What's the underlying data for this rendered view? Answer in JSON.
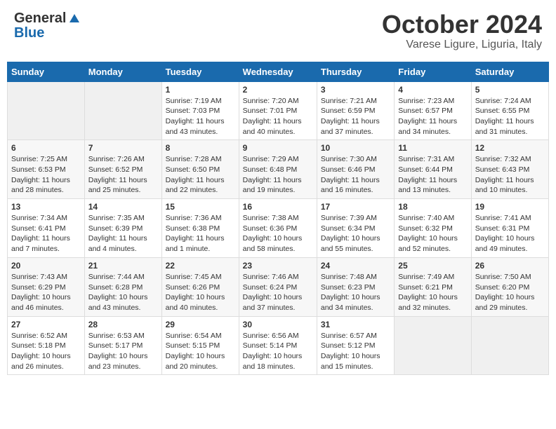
{
  "header": {
    "logo_general": "General",
    "logo_blue": "Blue",
    "month": "October 2024",
    "location": "Varese Ligure, Liguria, Italy"
  },
  "weekdays": [
    "Sunday",
    "Monday",
    "Tuesday",
    "Wednesday",
    "Thursday",
    "Friday",
    "Saturday"
  ],
  "weeks": [
    [
      {
        "day": "",
        "sunrise": "",
        "sunset": "",
        "daylight": ""
      },
      {
        "day": "",
        "sunrise": "",
        "sunset": "",
        "daylight": ""
      },
      {
        "day": "1",
        "sunrise": "Sunrise: 7:19 AM",
        "sunset": "Sunset: 7:03 PM",
        "daylight": "Daylight: 11 hours and 43 minutes."
      },
      {
        "day": "2",
        "sunrise": "Sunrise: 7:20 AM",
        "sunset": "Sunset: 7:01 PM",
        "daylight": "Daylight: 11 hours and 40 minutes."
      },
      {
        "day": "3",
        "sunrise": "Sunrise: 7:21 AM",
        "sunset": "Sunset: 6:59 PM",
        "daylight": "Daylight: 11 hours and 37 minutes."
      },
      {
        "day": "4",
        "sunrise": "Sunrise: 7:23 AM",
        "sunset": "Sunset: 6:57 PM",
        "daylight": "Daylight: 11 hours and 34 minutes."
      },
      {
        "day": "5",
        "sunrise": "Sunrise: 7:24 AM",
        "sunset": "Sunset: 6:55 PM",
        "daylight": "Daylight: 11 hours and 31 minutes."
      }
    ],
    [
      {
        "day": "6",
        "sunrise": "Sunrise: 7:25 AM",
        "sunset": "Sunset: 6:53 PM",
        "daylight": "Daylight: 11 hours and 28 minutes."
      },
      {
        "day": "7",
        "sunrise": "Sunrise: 7:26 AM",
        "sunset": "Sunset: 6:52 PM",
        "daylight": "Daylight: 11 hours and 25 minutes."
      },
      {
        "day": "8",
        "sunrise": "Sunrise: 7:28 AM",
        "sunset": "Sunset: 6:50 PM",
        "daylight": "Daylight: 11 hours and 22 minutes."
      },
      {
        "day": "9",
        "sunrise": "Sunrise: 7:29 AM",
        "sunset": "Sunset: 6:48 PM",
        "daylight": "Daylight: 11 hours and 19 minutes."
      },
      {
        "day": "10",
        "sunrise": "Sunrise: 7:30 AM",
        "sunset": "Sunset: 6:46 PM",
        "daylight": "Daylight: 11 hours and 16 minutes."
      },
      {
        "day": "11",
        "sunrise": "Sunrise: 7:31 AM",
        "sunset": "Sunset: 6:44 PM",
        "daylight": "Daylight: 11 hours and 13 minutes."
      },
      {
        "day": "12",
        "sunrise": "Sunrise: 7:32 AM",
        "sunset": "Sunset: 6:43 PM",
        "daylight": "Daylight: 11 hours and 10 minutes."
      }
    ],
    [
      {
        "day": "13",
        "sunrise": "Sunrise: 7:34 AM",
        "sunset": "Sunset: 6:41 PM",
        "daylight": "Daylight: 11 hours and 7 minutes."
      },
      {
        "day": "14",
        "sunrise": "Sunrise: 7:35 AM",
        "sunset": "Sunset: 6:39 PM",
        "daylight": "Daylight: 11 hours and 4 minutes."
      },
      {
        "day": "15",
        "sunrise": "Sunrise: 7:36 AM",
        "sunset": "Sunset: 6:38 PM",
        "daylight": "Daylight: 11 hours and 1 minute."
      },
      {
        "day": "16",
        "sunrise": "Sunrise: 7:38 AM",
        "sunset": "Sunset: 6:36 PM",
        "daylight": "Daylight: 10 hours and 58 minutes."
      },
      {
        "day": "17",
        "sunrise": "Sunrise: 7:39 AM",
        "sunset": "Sunset: 6:34 PM",
        "daylight": "Daylight: 10 hours and 55 minutes."
      },
      {
        "day": "18",
        "sunrise": "Sunrise: 7:40 AM",
        "sunset": "Sunset: 6:32 PM",
        "daylight": "Daylight: 10 hours and 52 minutes."
      },
      {
        "day": "19",
        "sunrise": "Sunrise: 7:41 AM",
        "sunset": "Sunset: 6:31 PM",
        "daylight": "Daylight: 10 hours and 49 minutes."
      }
    ],
    [
      {
        "day": "20",
        "sunrise": "Sunrise: 7:43 AM",
        "sunset": "Sunset: 6:29 PM",
        "daylight": "Daylight: 10 hours and 46 minutes."
      },
      {
        "day": "21",
        "sunrise": "Sunrise: 7:44 AM",
        "sunset": "Sunset: 6:28 PM",
        "daylight": "Daylight: 10 hours and 43 minutes."
      },
      {
        "day": "22",
        "sunrise": "Sunrise: 7:45 AM",
        "sunset": "Sunset: 6:26 PM",
        "daylight": "Daylight: 10 hours and 40 minutes."
      },
      {
        "day": "23",
        "sunrise": "Sunrise: 7:46 AM",
        "sunset": "Sunset: 6:24 PM",
        "daylight": "Daylight: 10 hours and 37 minutes."
      },
      {
        "day": "24",
        "sunrise": "Sunrise: 7:48 AM",
        "sunset": "Sunset: 6:23 PM",
        "daylight": "Daylight: 10 hours and 34 minutes."
      },
      {
        "day": "25",
        "sunrise": "Sunrise: 7:49 AM",
        "sunset": "Sunset: 6:21 PM",
        "daylight": "Daylight: 10 hours and 32 minutes."
      },
      {
        "day": "26",
        "sunrise": "Sunrise: 7:50 AM",
        "sunset": "Sunset: 6:20 PM",
        "daylight": "Daylight: 10 hours and 29 minutes."
      }
    ],
    [
      {
        "day": "27",
        "sunrise": "Sunrise: 6:52 AM",
        "sunset": "Sunset: 5:18 PM",
        "daylight": "Daylight: 10 hours and 26 minutes."
      },
      {
        "day": "28",
        "sunrise": "Sunrise: 6:53 AM",
        "sunset": "Sunset: 5:17 PM",
        "daylight": "Daylight: 10 hours and 23 minutes."
      },
      {
        "day": "29",
        "sunrise": "Sunrise: 6:54 AM",
        "sunset": "Sunset: 5:15 PM",
        "daylight": "Daylight: 10 hours and 20 minutes."
      },
      {
        "day": "30",
        "sunrise": "Sunrise: 6:56 AM",
        "sunset": "Sunset: 5:14 PM",
        "daylight": "Daylight: 10 hours and 18 minutes."
      },
      {
        "day": "31",
        "sunrise": "Sunrise: 6:57 AM",
        "sunset": "Sunset: 5:12 PM",
        "daylight": "Daylight: 10 hours and 15 minutes."
      },
      {
        "day": "",
        "sunrise": "",
        "sunset": "",
        "daylight": ""
      },
      {
        "day": "",
        "sunrise": "",
        "sunset": "",
        "daylight": ""
      }
    ]
  ]
}
